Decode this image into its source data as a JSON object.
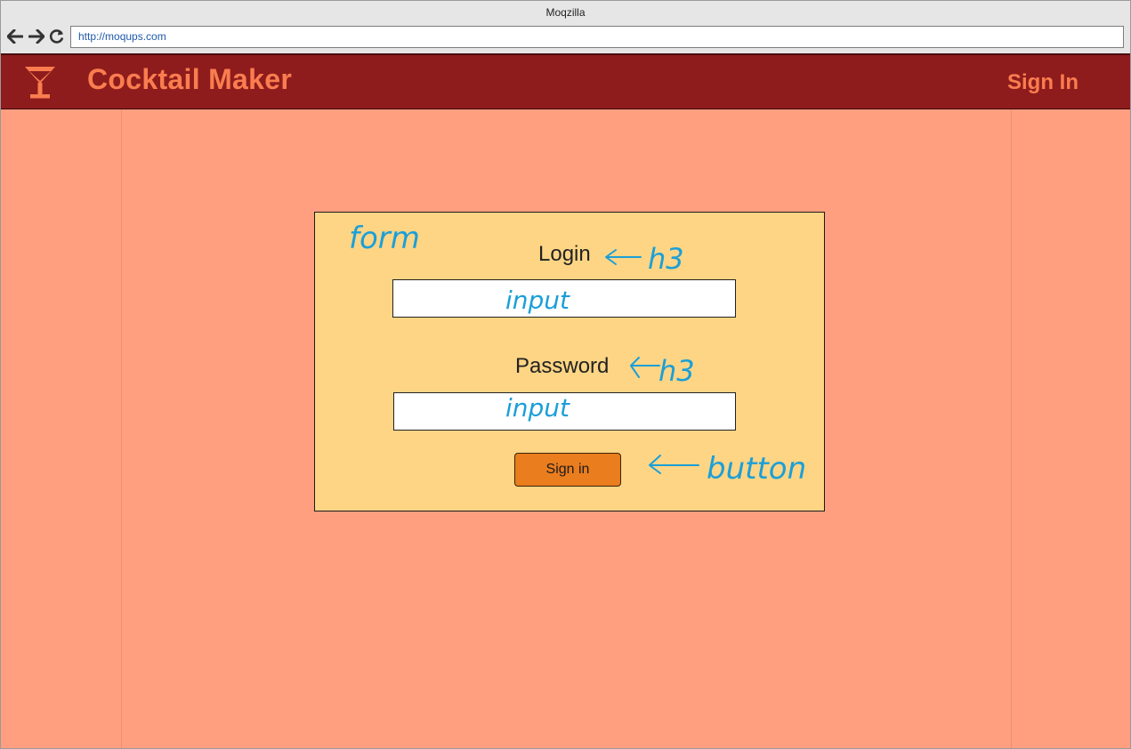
{
  "window": {
    "title": "Moqzilla"
  },
  "browser": {
    "url": "http://moqups.com",
    "back_icon": "arrow-left-icon",
    "forward_icon": "arrow-right-icon",
    "reload_icon": "reload-icon"
  },
  "header": {
    "logo_icon": "cocktail-glass-icon",
    "title": "Cocktail Maker",
    "sign_in_link": "Sign In"
  },
  "form": {
    "login_label": "Login",
    "password_label": "Password",
    "submit_label": "Sign in"
  },
  "annotations": {
    "form_note": "form",
    "login_note": "h3",
    "login_input_note": "input",
    "password_note": "h3",
    "password_input_note": "input",
    "button_note": "button"
  },
  "colors": {
    "navbar": "#8f1c1c",
    "brand_text": "#f97d4f",
    "page_background": "#ff9f80",
    "form_background": "#fdd584",
    "button": "#ea7d1e",
    "annotation": "#1b9fd8"
  }
}
